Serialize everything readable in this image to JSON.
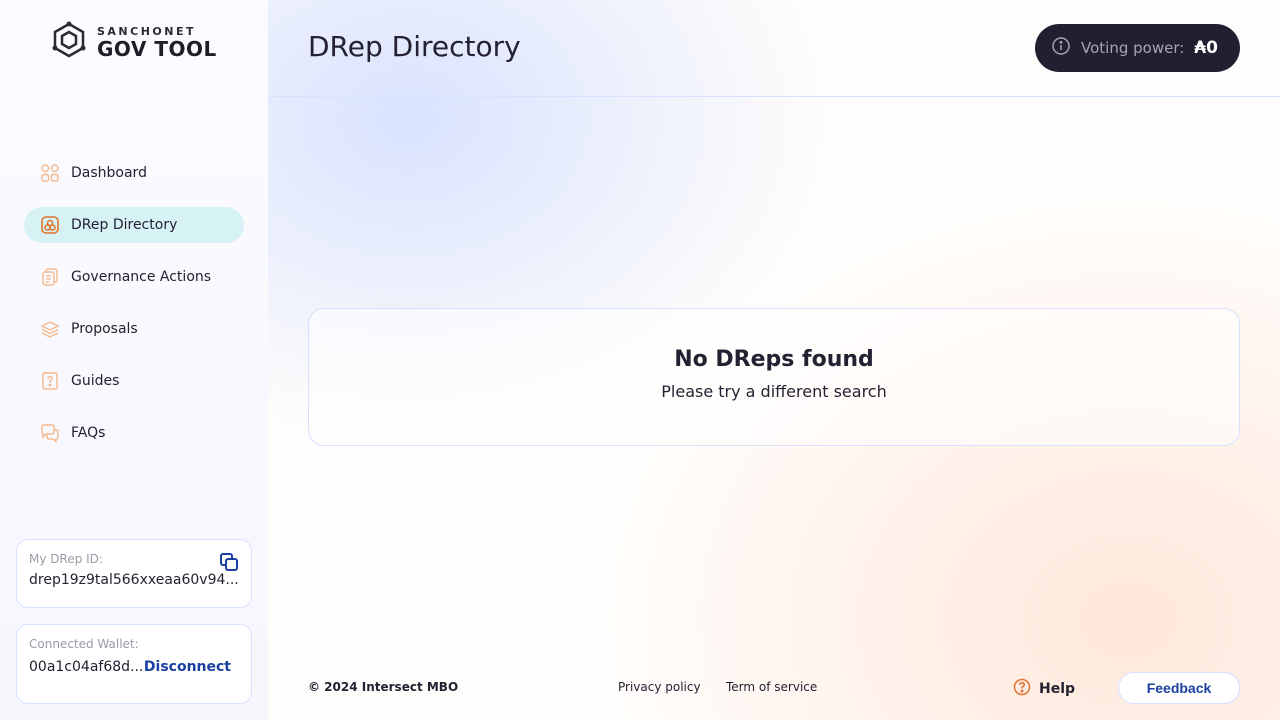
{
  "logo": {
    "small": "SANCHONET",
    "big": "GOV TOOL",
    "icon": "gov-tool-logo-icon"
  },
  "nav": {
    "items": [
      {
        "label": "Dashboard",
        "icon": "dashboard-icon"
      },
      {
        "label": "DRep Directory",
        "icon": "drep-directory-icon",
        "active": true
      },
      {
        "label": "Governance Actions",
        "icon": "governance-actions-icon"
      },
      {
        "label": "Proposals",
        "icon": "proposals-icon"
      },
      {
        "label": "Guides",
        "icon": "guides-icon"
      },
      {
        "label": "FAQs",
        "icon": "faqs-icon"
      }
    ]
  },
  "drep_card": {
    "label": "My DRep ID:",
    "value": "drep19z9tal566xxeaa60v94..."
  },
  "wallet_card": {
    "label": "Connected Wallet:",
    "address": "00a1c04af68d...",
    "disconnect_label": "Disconnect"
  },
  "header": {
    "title": "DRep Directory",
    "voting_power_label": "Voting power:",
    "voting_power_value": "₳0"
  },
  "empty_state": {
    "title": "No DReps found",
    "subtitle": "Please try a different search"
  },
  "footer": {
    "copyright": "© 2024 Intersect MBO",
    "privacy": "Privacy policy",
    "terms": "Term of service",
    "help": "Help",
    "feedback": "Feedback"
  },
  "colors": {
    "accent_orange": "#f08a4b",
    "link_blue": "#1b3ea1",
    "active_nav_bg": "#d6f2f4",
    "dark_pill": "#212030",
    "border": "#d6e2ff"
  }
}
